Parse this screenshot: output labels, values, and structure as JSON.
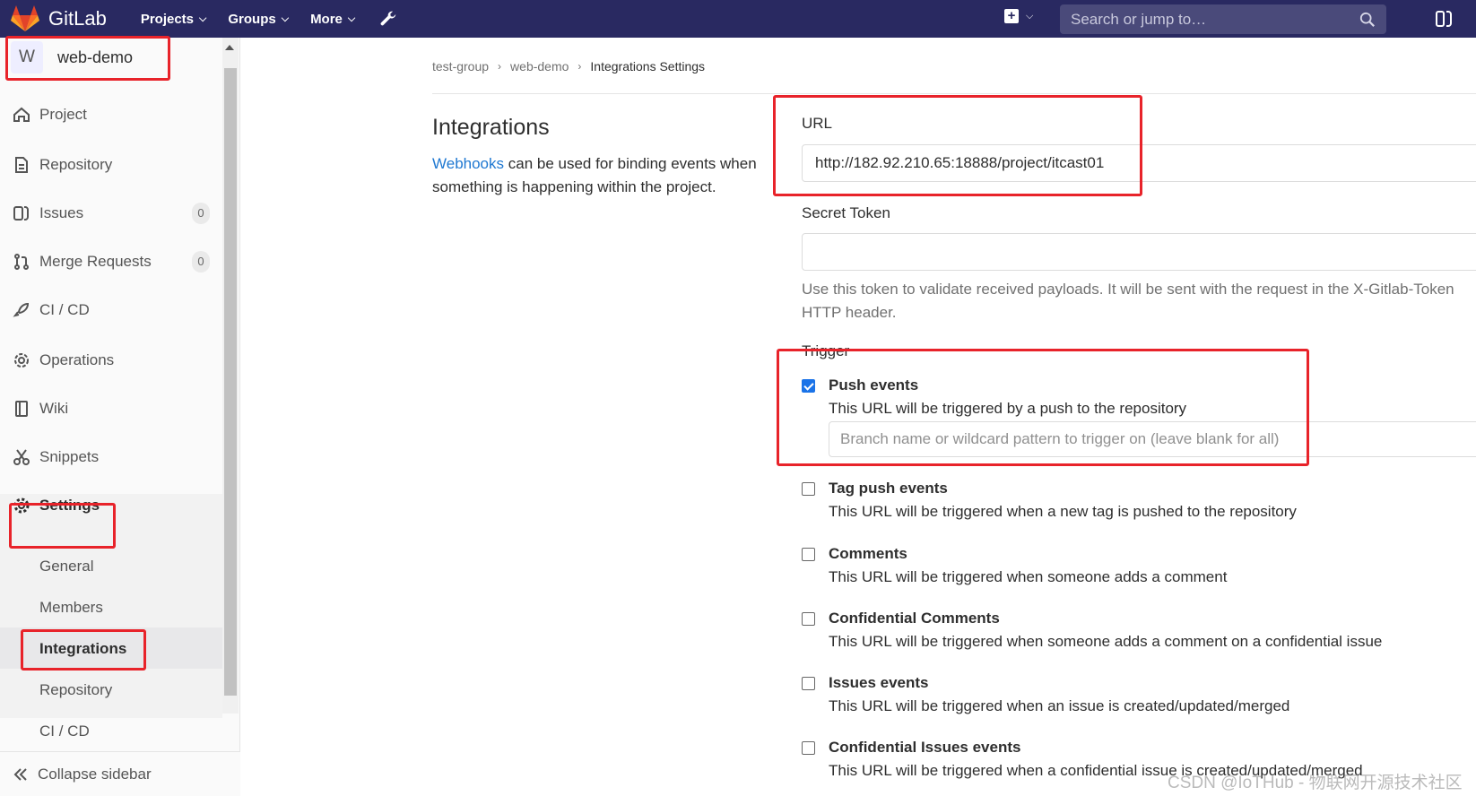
{
  "topbar": {
    "brand": "GitLab",
    "nav": [
      {
        "label": "Projects"
      },
      {
        "label": "Groups"
      },
      {
        "label": "More"
      }
    ],
    "search_placeholder": "Search or jump to…"
  },
  "sidebar": {
    "project_initial": "W",
    "project_name": "web-demo",
    "items": [
      {
        "label": "Project"
      },
      {
        "label": "Repository"
      },
      {
        "label": "Issues",
        "count": "0"
      },
      {
        "label": "Merge Requests",
        "count": "0"
      },
      {
        "label": "CI / CD"
      },
      {
        "label": "Operations"
      },
      {
        "label": "Wiki"
      },
      {
        "label": "Snippets"
      },
      {
        "label": "Settings"
      }
    ],
    "settings_sub": [
      {
        "label": "General"
      },
      {
        "label": "Members"
      },
      {
        "label": "Integrations"
      },
      {
        "label": "Repository"
      },
      {
        "label": "CI / CD"
      }
    ],
    "collapse_label": "Collapse sidebar"
  },
  "breadcrumb": [
    "test-group",
    "web-demo",
    "Integrations Settings"
  ],
  "intro": {
    "title": "Integrations",
    "link_text": "Webhooks",
    "description_rest": " can be used for binding events when something is happening within the project."
  },
  "form": {
    "url_label": "URL",
    "url_value": "http://182.92.210.65:18888/project/itcast01",
    "secret_label": "Secret Token",
    "secret_value": "",
    "secret_hint": "Use this token to validate received payloads. It will be sent with the request in the X-Gitlab-Token HTTP header.",
    "trigger_label": "Trigger",
    "branch_placeholder": "Branch name or wildcard pattern to trigger on (leave blank for all)"
  },
  "events": [
    {
      "title": "Push events",
      "desc": "This URL will be triggered by a push to the repository",
      "checked": true
    },
    {
      "title": "Tag push events",
      "desc": "This URL will be triggered when a new tag is pushed to the repository",
      "checked": false
    },
    {
      "title": "Comments",
      "desc": "This URL will be triggered when someone adds a comment",
      "checked": false
    },
    {
      "title": "Confidential Comments",
      "desc": "This URL will be triggered when someone adds a comment on a confidential issue",
      "checked": false
    },
    {
      "title": "Issues events",
      "desc": "This URL will be triggered when an issue is created/updated/merged",
      "checked": false
    },
    {
      "title": "Confidential Issues events",
      "desc": "This URL will be triggered when a confidential issue is created/updated/merged",
      "checked": false
    }
  ],
  "watermark": "CSDN @IoTHub - 物联网开源技术社区",
  "colors": {
    "nav_bg": "#292961",
    "link": "#1f78d1",
    "annotation": "#e8232a",
    "checkbox": "#1a73e8"
  }
}
